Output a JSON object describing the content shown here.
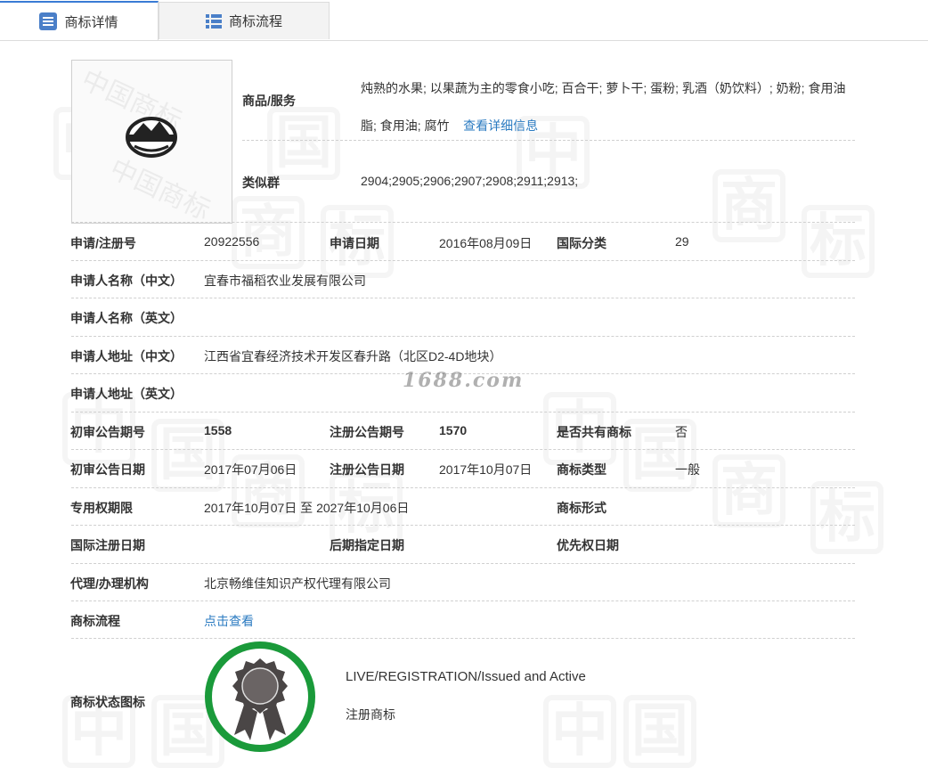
{
  "tabs": [
    {
      "label": "商标详情",
      "icon": "document-icon"
    },
    {
      "label": "商标流程",
      "icon": "list-icon"
    }
  ],
  "goods": {
    "label": "商品/服务",
    "text": "炖熟的水果; 以果蔬为主的零食小吃; 百合干; 萝卜干; 蛋粉; 乳酒（奶饮料）; 奶粉; 食用油脂; 食用油; 腐竹",
    "more_link": "查看详细信息"
  },
  "similar_group": {
    "label": "类似群",
    "value": "2904;2905;2906;2907;2908;2911;2913;"
  },
  "details": {
    "reg_no_label": "申请/注册号",
    "reg_no": "20922556",
    "apply_date_label": "申请日期",
    "apply_date": "2016年08月09日",
    "intl_class_label": "国际分类",
    "intl_class": "29",
    "applicant_cn_label": "申请人名称（中文）",
    "applicant_cn": "宜春市福稻农业发展有限公司",
    "applicant_en_label": "申请人名称（英文）",
    "applicant_en": "",
    "address_cn_label": "申请人地址（中文）",
    "address_cn": "江西省宜春经济技术开发区春升路（北区D2-4D地块）",
    "address_en_label": "申请人地址（英文）",
    "address_en": "",
    "prelim_no_label": "初审公告期号",
    "prelim_no": "1558",
    "reg_pub_no_label": "注册公告期号",
    "reg_pub_no": "1570",
    "shared_label": "是否共有商标",
    "shared": "否",
    "prelim_date_label": "初审公告日期",
    "prelim_date": "2017年07月06日",
    "reg_pub_date_label": "注册公告日期",
    "reg_pub_date": "2017年10月07日",
    "tm_type_label": "商标类型",
    "tm_type": "一般",
    "exclusive_label": "专用权期限",
    "exclusive": "2017年10月07日 至 2027年10月06日",
    "tm_form_label": "商标形式",
    "tm_form": "",
    "intl_reg_date_label": "国际注册日期",
    "intl_reg_date": "",
    "later_date_label": "后期指定日期",
    "later_date": "",
    "priority_date_label": "优先权日期",
    "priority_date": "",
    "agent_label": "代理/办理机构",
    "agent": "北京畅维佳知识产权代理有限公司",
    "flow_label": "商标流程",
    "flow_link": "点击查看"
  },
  "status": {
    "label": "商标状态图标",
    "en": "LIVE/REGISTRATION/Issued and Active",
    "cn": "注册商标",
    "ring_color": "#1a9a3a",
    "icon": "award-ribbon-icon"
  },
  "watermark": {
    "site": "1688.com",
    "chars": [
      "中",
      "国",
      "商",
      "标"
    ],
    "logo_text": "中国商标"
  },
  "colors": {
    "accent": "#3a7bd5",
    "link": "#2b7bc1"
  }
}
